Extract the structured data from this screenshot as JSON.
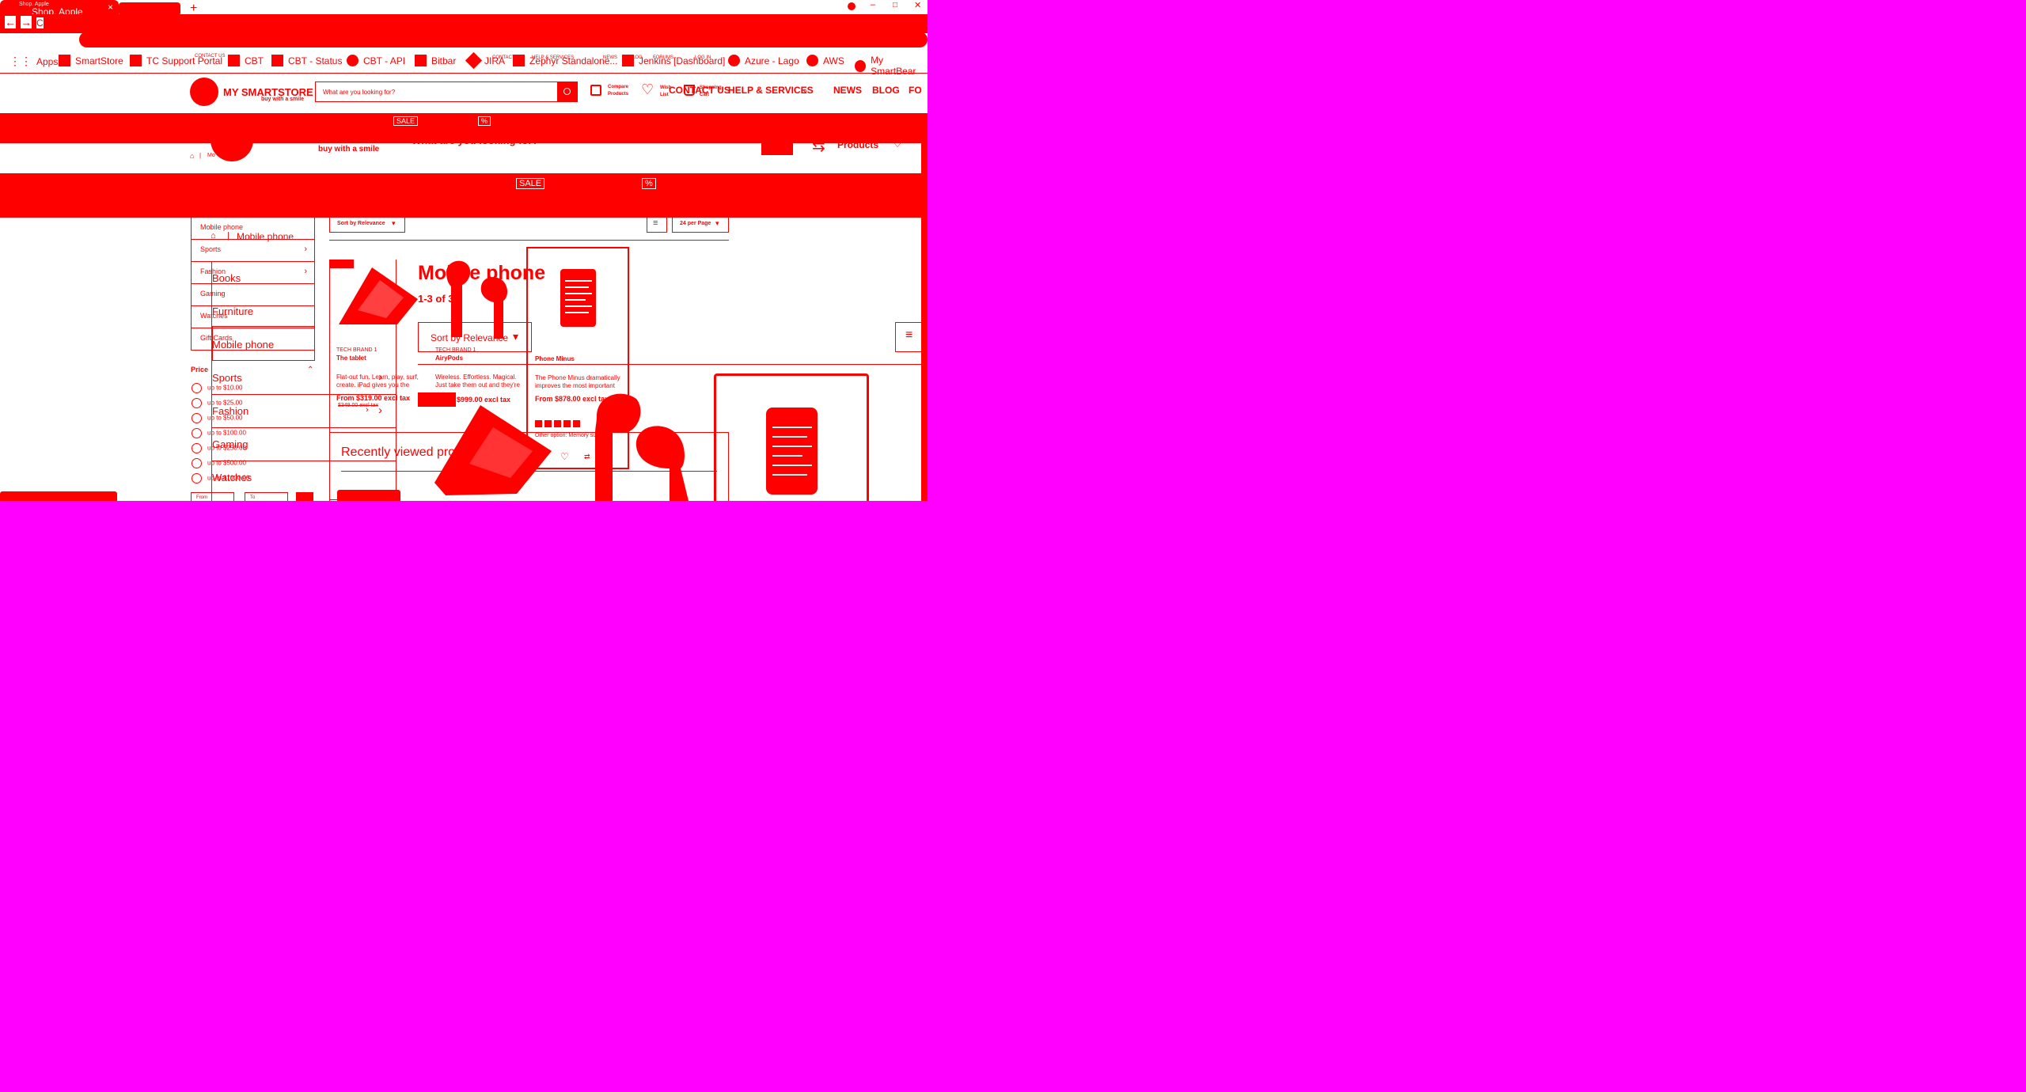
{
  "browser": {
    "tab_title": "Shop. Apple",
    "tab_title_echo": "Shop. Apple",
    "new_tab_symbol": "+",
    "close_symbol": "×",
    "window_controls": [
      "–",
      "□",
      "✕"
    ],
    "nav_back": "←",
    "nav_forward": "→",
    "nav_reload": "C",
    "mini_bookmarks": [
      "Apps",
      "SmartStore"
    ]
  },
  "bookmarks": [
    {
      "label": "Apps",
      "icon": "apps-grid-icon"
    },
    {
      "label": "SmartStore",
      "icon": "bookmark-icon"
    },
    {
      "label": "TC Support Portal",
      "icon": "bookmark-icon"
    },
    {
      "label": "CBT",
      "icon": "bookmark-icon"
    },
    {
      "label": "CBT - Status",
      "icon": "bookmark-icon"
    },
    {
      "label": "CBT - API",
      "icon": "bookmark-icon"
    },
    {
      "label": "Bitbar",
      "icon": "bookmark-icon"
    },
    {
      "label": "JIRA",
      "icon": "bookmark-icon"
    },
    {
      "label": "Zephyr Standalone...",
      "icon": "bookmark-icon"
    },
    {
      "label": "Jenkins [Dashboard]",
      "icon": "bookmark-icon"
    },
    {
      "label": "Azure - Lago",
      "icon": "bookmark-icon"
    },
    {
      "label": "AWS",
      "icon": "bookmark-icon"
    },
    {
      "label": "My SmartBear",
      "icon": "bookmark-icon"
    }
  ],
  "overlay_small": {
    "top_links": [
      "CONTACT US",
      "HELP & SERVICES",
      "NEWS",
      "BLOG",
      "FORUMS",
      "LOG IN"
    ],
    "shopping_cart": "Shopping Cart",
    "wish_list": "Wish List"
  },
  "store": {
    "logo_text": "MY SMARTSTORE",
    "logo_tagline": "buy with a smile",
    "search_placeholder": "What are you looking for?",
    "compare_label": "Compare Products",
    "wishlist_label": "Wish list",
    "cart_label": "Shopping Cart",
    "nav_items": [
      "CONTACT US",
      "HELP & SERVICES",
      "NEWS",
      "BLOG",
      "FO"
    ],
    "sale_tag": "SALE",
    "sale_tag_large": "SALE",
    "percent_tag": "%",
    "products_label": "Products",
    "echo_search": "What are you looking for?"
  },
  "breadcrumb": {
    "small": "Mo",
    "large": "Mobile phone"
  },
  "sidebar": {
    "items": [
      {
        "label": "Mobile phone",
        "chevron": false
      },
      {
        "label": "Sports",
        "chevron": true
      },
      {
        "label": "Fashion",
        "chevron": true
      },
      {
        "label": "Gaming",
        "chevron": false
      },
      {
        "label": "Watches",
        "chevron": false
      },
      {
        "label": "Gift Cards",
        "chevron": false
      }
    ],
    "big_items": [
      "Books",
      "Furniture",
      "Mobile phone",
      "Sports",
      "Fashion",
      "Gaming",
      "Watches"
    ],
    "price_title": "Price",
    "price_options": [
      "up to $10.00",
      "up to $25.00",
      "up to $50.00",
      "up to $100.00",
      "up to $250.00",
      "up to $500.00",
      "up to $1000.00"
    ],
    "price_from_placeholder": "From",
    "price_to_placeholder": "To"
  },
  "listing": {
    "title": "Mobile phone",
    "results_summary": "1-3 of 3",
    "sort_label_small": "Sort by Relevance",
    "sort_label_large": "Sort by Relevance",
    "per_page": "24 per Page",
    "recently_viewed": "Recently viewed products"
  },
  "products": [
    {
      "brand": "TECH BRAND 1",
      "name": "The tablet",
      "description": "Flat-out fun. Learn, play, surf, create. iPad gives you the",
      "price": "From $319.00 excl tax",
      "old_price": "$349.00 excl tax"
    },
    {
      "brand": "TECH BRAND 1",
      "name": "AiryPods",
      "description": "Wireless. Effortless. Magical. Just take them out and they're",
      "price": "$999.00 excl tax"
    },
    {
      "brand": "",
      "name": "Phone Minus",
      "description": "The Phone Minus dramatically improves the most important",
      "price": "From $878.00 excl tax",
      "other_option": "Other option: Memory size"
    }
  ],
  "colors": {
    "accent": "#ff0000",
    "background": "#ff00ff",
    "page": "#ffffff"
  }
}
